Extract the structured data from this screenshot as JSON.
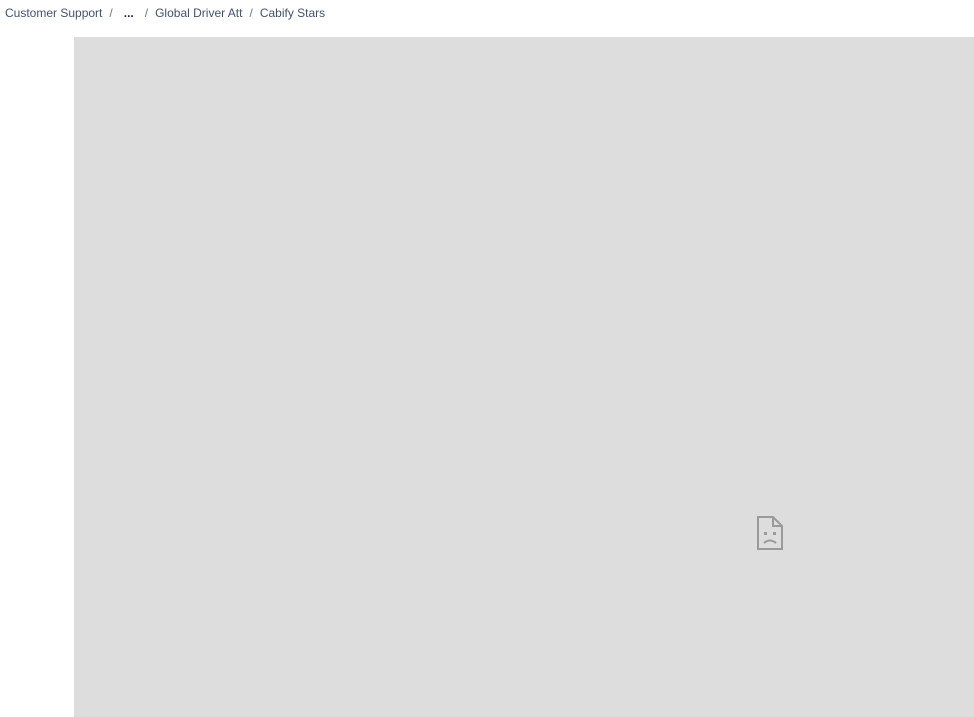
{
  "breadcrumb": {
    "items": [
      {
        "label": "Customer Support"
      },
      {
        "label": "..."
      },
      {
        "label": "Global Driver Att"
      },
      {
        "label": "Cabify Stars"
      }
    ],
    "separator": "/"
  },
  "embed": {
    "background": "#dddddd",
    "status_icon": "sad-page-icon"
  }
}
